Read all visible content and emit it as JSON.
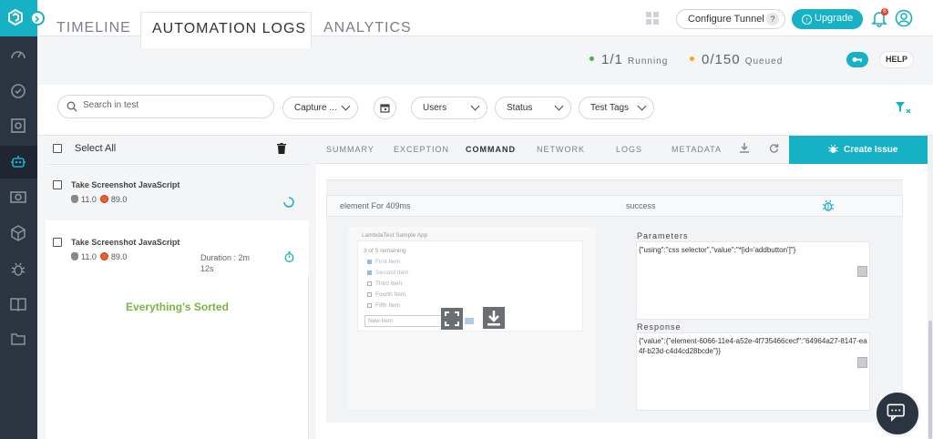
{
  "topbar": {
    "configure_tunnel": "Configure Tunnel",
    "help_q": "?",
    "upgrade": "Upgrade",
    "upgrade_arrow": "↑",
    "notification_count": "6"
  },
  "tabs": [
    "TIMELINE",
    "AUTOMATION LOGS",
    "ANALYTICS"
  ],
  "stats": {
    "running_value": "1/1",
    "running_label": "Running",
    "running_color": "#4caf50",
    "queued_value": "0/150",
    "queued_label": "Queued",
    "queued_color": "#f5a623"
  },
  "help_button": "HELP",
  "filters": {
    "search_placeholder": "Search in test",
    "capture": "Capture ...",
    "users": "Users",
    "status": "Status",
    "test_tags": "Test Tags"
  },
  "left": {
    "select_all": "Select All",
    "tests": [
      {
        "title": "Take Screenshot JavaScript",
        "os_version": "11.0",
        "browser_version": "89.0",
        "duration": ""
      },
      {
        "title": "Take Screenshot JavaScript",
        "os_version": "11.0",
        "browser_version": "89.0",
        "duration_line1": "Duration : 2m",
        "duration_line2": "12s"
      }
    ],
    "sorted": "Everything's Sorted"
  },
  "right": {
    "tabs": [
      "SUMMARY",
      "EXCEPTION",
      "COMMAND",
      "NETWORK",
      "LOGS",
      "METADATA"
    ],
    "active_tab": "COMMAND",
    "create_issue": "Create Issue",
    "command": {
      "name": "element For 409ms",
      "status": "success",
      "parameters_label": "Parameters",
      "parameters": "{\"using\":\"css selector\",\"value\":\"*[id='addbutton']\"}",
      "response_label": "Response",
      "response": "{\"value\":{\"element-6066-11e4-a52e-4f735466cecf\":\"64964a27-8147-ea4f-b23d-c4d4cd28bcde\"}}"
    },
    "screenshot": {
      "app_title": "LambdaTest Sample App",
      "remaining": "3 of 5 remaining",
      "items": [
        {
          "label": "First Item",
          "done": true
        },
        {
          "label": "Second Item",
          "done": true
        },
        {
          "label": "Third Item",
          "done": false
        },
        {
          "label": "Fourth Item",
          "done": false
        },
        {
          "label": "Fifth Item",
          "done": false
        }
      ],
      "new_item_placeholder": "New Item"
    }
  },
  "accent_color": "#16b1c4"
}
